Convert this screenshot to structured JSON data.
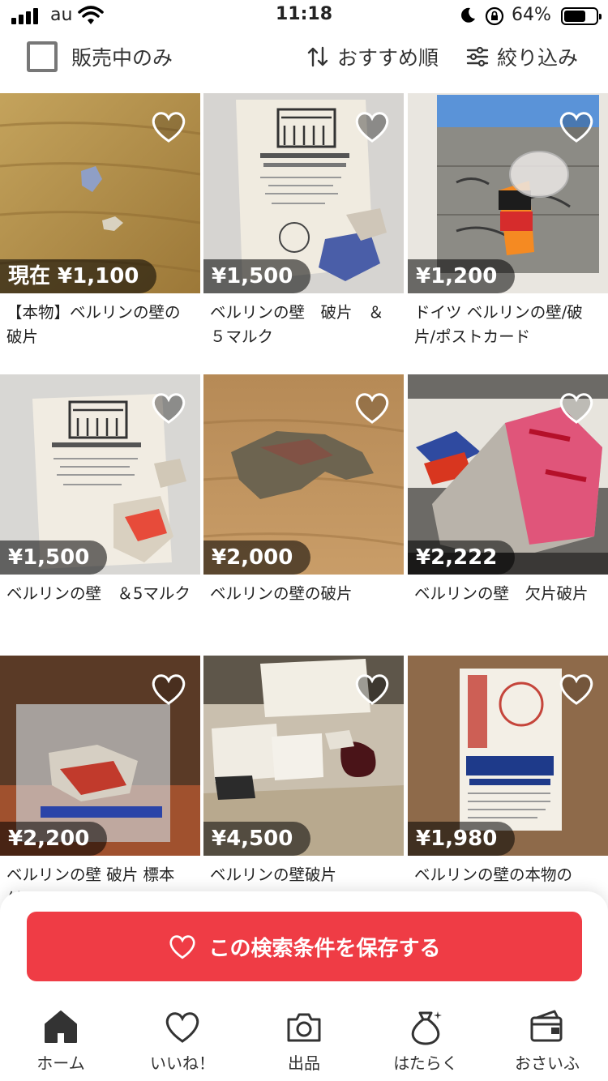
{
  "status": {
    "carrier": "au",
    "time": "11:18",
    "battery": "64%"
  },
  "filter": {
    "only_sale": "販売中のみ",
    "sort": "おすすめ順",
    "refine": "絞り込み"
  },
  "items": [
    {
      "price": "現在 ¥1,100",
      "title": "【本物】ベルリンの壁の破片"
    },
    {
      "price": "¥1,500",
      "title": "ベルリンの壁　破片　＆５マルク"
    },
    {
      "price": "¥1,200",
      "title": "ドイツ ベルリンの壁/破片/ポストカード"
    },
    {
      "price": "¥1,500",
      "title": "ベルリンの壁　＆5マルク"
    },
    {
      "price": "¥2,000",
      "title": "ベルリンの壁の破片"
    },
    {
      "price": "¥2,222",
      "title": "ベルリンの壁　欠片破片"
    },
    {
      "price": "¥2,200",
      "title": "ベルリンの壁 破片 標本 付"
    },
    {
      "price": "¥4,500",
      "title": "ベルリンの壁破片"
    },
    {
      "price": "¥1,980",
      "title": "ベルリンの壁の本物の"
    }
  ],
  "save_search": {
    "label": "この検索条件を保存する"
  },
  "tabs": [
    {
      "label": "ホーム",
      "icon": "home-icon"
    },
    {
      "label": "いいね！",
      "icon": "heart-icon"
    },
    {
      "label": "出品",
      "icon": "camera-icon"
    },
    {
      "label": "はたらく",
      "icon": "money-bag-icon"
    },
    {
      "label": "おさいふ",
      "icon": "wallet-icon"
    }
  ],
  "colors": {
    "accent": "#ef3c45"
  }
}
